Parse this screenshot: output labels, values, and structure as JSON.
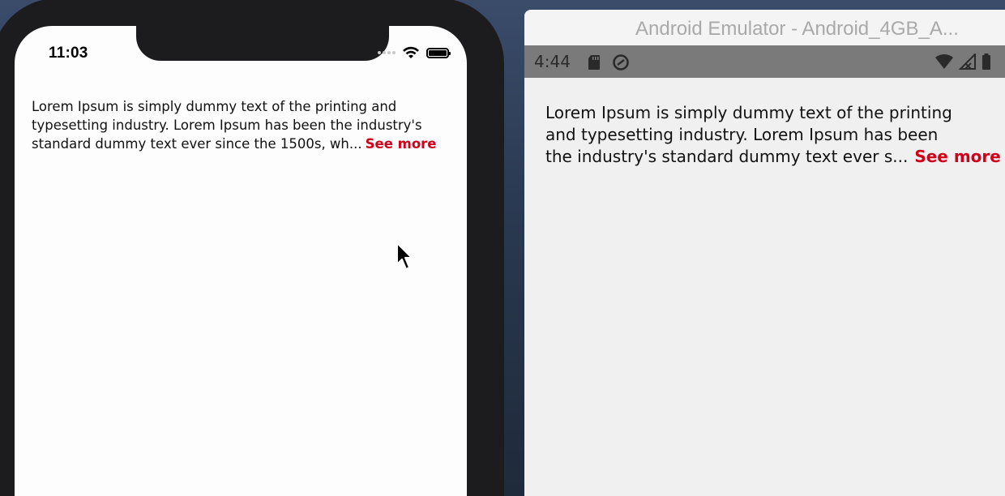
{
  "ios": {
    "status_time": "11:03",
    "text_lines": [
      "Lorem Ipsum is simply dummy text of the printing and",
      "typesetting industry. Lorem Ipsum has been the industry's",
      "standard dummy text ever since the 1500s, wh..."
    ],
    "see_more_label": "See more"
  },
  "android": {
    "window_title": "Android Emulator - Android_4GB_A...",
    "status_time": "4:44",
    "text_lines": [
      "Lorem Ipsum is simply dummy text of the printing",
      "and typesetting industry. Lorem Ipsum has been",
      "the industry's standard dummy text ever s..."
    ],
    "see_more_label": "See more"
  },
  "colors": {
    "accent_red": "#d0021b",
    "android_statusbar": "#7a7a7a",
    "ios_bezel": "#1c1c1e"
  },
  "icons": {
    "ios": [
      "cellular-signal-icon",
      "wifi-icon",
      "battery-icon"
    ],
    "android": [
      "sd-card-icon",
      "data-saver-icon",
      "wifi-icon",
      "cellular-signal-icon",
      "battery-icon"
    ],
    "cursor": "mouse-pointer-icon"
  }
}
